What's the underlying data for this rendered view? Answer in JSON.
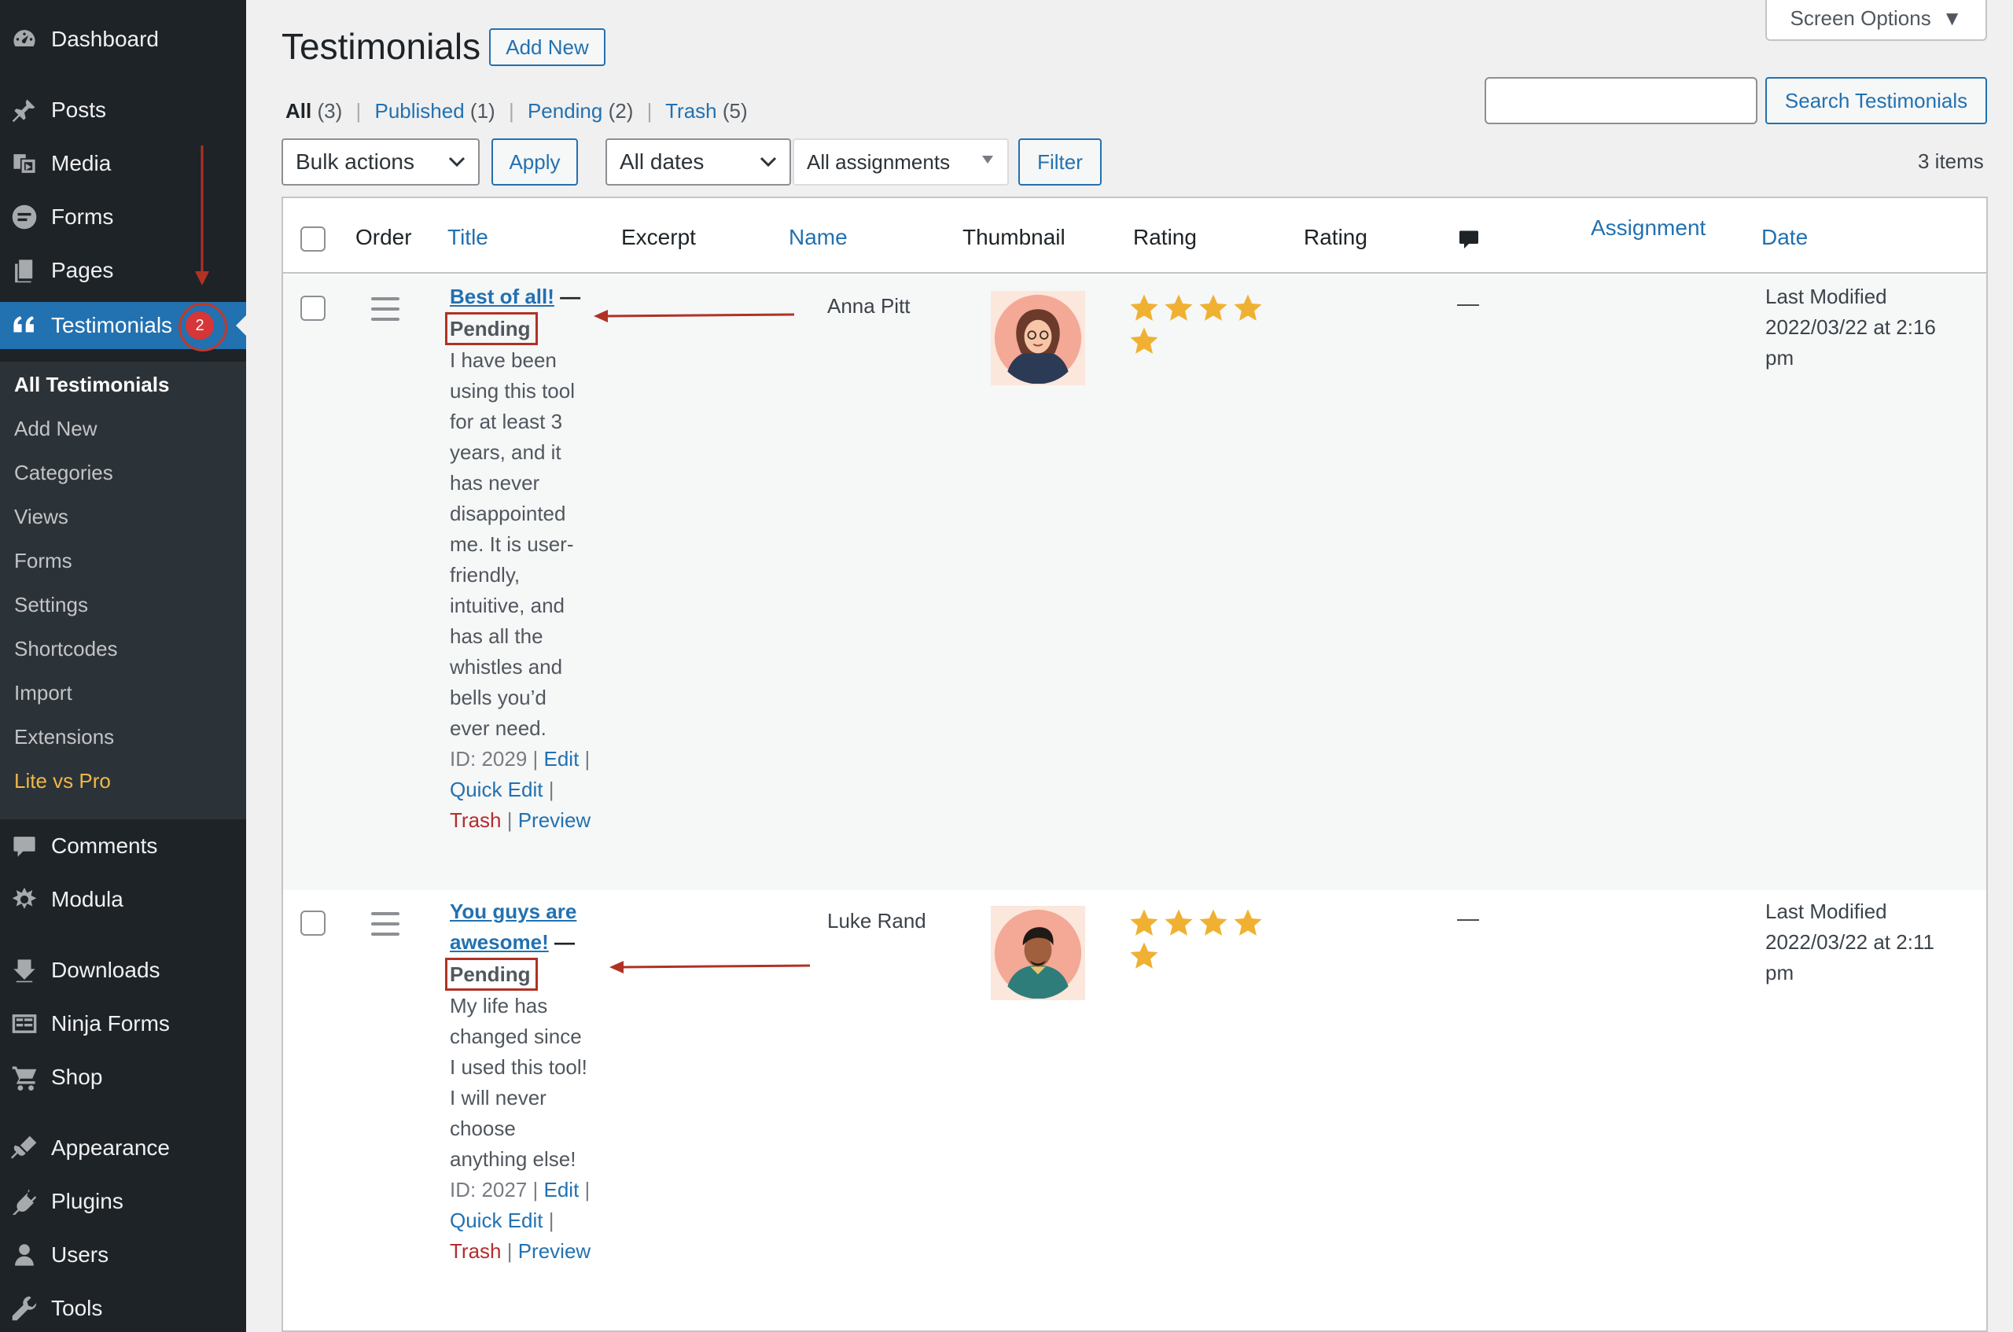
{
  "sidebar": {
    "items": [
      {
        "key": "dashboard",
        "label": "Dashboard",
        "icon": "dashboard-icon"
      },
      {
        "key": "posts",
        "label": "Posts",
        "icon": "pin-icon"
      },
      {
        "key": "media",
        "label": "Media",
        "icon": "media-icon"
      },
      {
        "key": "forms",
        "label": "Forms",
        "icon": "forms-icon"
      },
      {
        "key": "pages",
        "label": "Pages",
        "icon": "pages-icon"
      },
      {
        "key": "testimonials",
        "label": "Testimonials",
        "icon": "quote-icon",
        "badge": "2"
      },
      {
        "key": "comments",
        "label": "Comments",
        "icon": "comment-icon"
      },
      {
        "key": "modula",
        "label": "Modula",
        "icon": "gallery-icon"
      },
      {
        "key": "downloads",
        "label": "Downloads",
        "icon": "download-icon"
      },
      {
        "key": "ninja_forms",
        "label": "Ninja Forms",
        "icon": "ninja-forms-icon"
      },
      {
        "key": "shop",
        "label": "Shop",
        "icon": "cart-icon"
      },
      {
        "key": "appearance",
        "label": "Appearance",
        "icon": "brush-icon"
      },
      {
        "key": "plugins",
        "label": "Plugins",
        "icon": "plug-icon"
      },
      {
        "key": "users",
        "label": "Users",
        "icon": "user-icon"
      },
      {
        "key": "tools",
        "label": "Tools",
        "icon": "wrench-icon"
      }
    ],
    "submenu": [
      "All Testimonials",
      "Add New",
      "Categories",
      "Views",
      "Forms",
      "Settings",
      "Shortcodes",
      "Import",
      "Extensions",
      "Lite vs Pro"
    ]
  },
  "header": {
    "title": "Testimonials",
    "add_new": "Add New",
    "screen_options": "Screen Options"
  },
  "views": {
    "all": "All",
    "all_count": "(3)",
    "published": "Published",
    "published_count": "(1)",
    "pending": "Pending",
    "pending_count": "(2)",
    "trash": "Trash",
    "trash_count": "(5)",
    "sep": "|"
  },
  "search": {
    "button": "Search Testimonials",
    "value": ""
  },
  "filters": {
    "bulk_actions": "Bulk actions",
    "apply": "Apply",
    "dates": "All dates",
    "assignments": "All assignments",
    "filter": "Filter",
    "items_count": "3 items"
  },
  "table": {
    "columns": {
      "order": "Order",
      "title": "Title",
      "excerpt": "Excerpt",
      "name": "Name",
      "thumbnail": "Thumbnail",
      "rating1": "Rating",
      "rating2": "Rating",
      "assignment": "Assignment",
      "date": "Date"
    },
    "rows": [
      {
        "title": "Best of all!",
        "dash": "—",
        "status": "Pending",
        "excerpt": "I have been using this tool for at least 3 years, and it has never disappointed me. It is user-friendly, intuitive, and has all the whistles and bells you’d ever need.",
        "id_label": "ID: 2029",
        "edit": "Edit",
        "quick_edit": "Quick Edit",
        "trash": "Trash",
        "preview": "Preview",
        "name": "Anna Pitt",
        "rating": 5,
        "comments": "—",
        "date_line1": "Last Modified",
        "date_line2": "2022/03/22 at 2:16",
        "date_line3": "pm"
      },
      {
        "title": "You guys are awesome!",
        "dash": "—",
        "status": "Pending",
        "excerpt": "My life has changed since I used this tool! I will never choose anything else!",
        "id_label": "ID: 2027",
        "edit": "Edit",
        "quick_edit": "Quick Edit",
        "trash": "Trash",
        "preview": "Preview",
        "name": "Luke Rand",
        "rating": 5,
        "comments": "—",
        "date_line1": "Last Modified",
        "date_line2": "2022/03/22 at 2:11",
        "date_line3": "pm"
      }
    ]
  },
  "colors": {
    "sidebar_bg": "#1d2327",
    "submenu_bg": "#2c3338",
    "accent": "#2271b1",
    "badge": "#d63638",
    "star": "#f0b132",
    "annotation": "#b03225"
  }
}
